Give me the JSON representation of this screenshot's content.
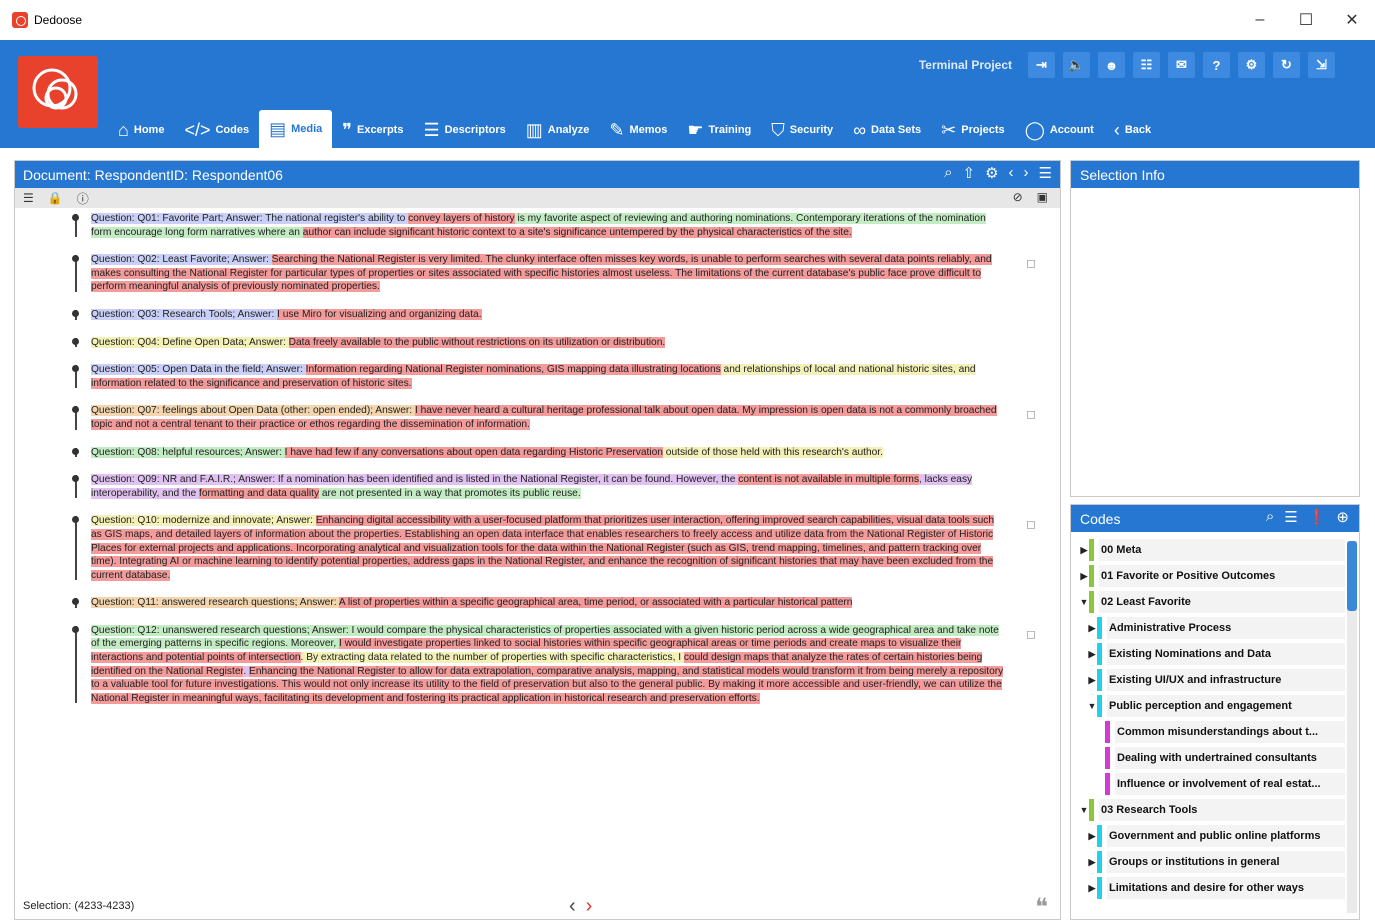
{
  "window": {
    "title": "Dedoose",
    "minimize": "–",
    "maximize": "☐",
    "close": "✕"
  },
  "header": {
    "project_name": "Terminal Project",
    "nav": [
      {
        "label": "Home",
        "icon": "home-icon",
        "glyph": "⌂"
      },
      {
        "label": "Codes",
        "icon": "code-icon",
        "glyph": "</>"
      },
      {
        "label": "Media",
        "icon": "media-icon",
        "glyph": "▤"
      },
      {
        "label": "Excerpts",
        "icon": "quote-icon",
        "glyph": "❞"
      },
      {
        "label": "Descriptors",
        "icon": "document-icon",
        "glyph": "☰"
      },
      {
        "label": "Analyze",
        "icon": "chart-icon",
        "glyph": "▥"
      },
      {
        "label": "Memos",
        "icon": "memo-icon",
        "glyph": "✎"
      },
      {
        "label": "Training",
        "icon": "training-icon",
        "glyph": "☛"
      },
      {
        "label": "Security",
        "icon": "shield-icon",
        "glyph": "⛉"
      },
      {
        "label": "Data Sets",
        "icon": "binoculars-icon",
        "glyph": "∞"
      },
      {
        "label": "Projects",
        "icon": "tools-icon",
        "glyph": "✂"
      },
      {
        "label": "Account",
        "icon": "user-icon",
        "glyph": "◯"
      },
      {
        "label": "Back",
        "icon": "back-icon",
        "glyph": "‹"
      }
    ],
    "active_nav": "Media"
  },
  "document": {
    "title": "Document: RespondentID: Respondent06",
    "paragraphs": [
      {
        "segments": [
          {
            "t": "Question: Q01: Favorite Part; Answer: The national register's ability to ",
            "c": "blue"
          },
          {
            "t": "convey layers of history",
            "c": "red"
          },
          {
            "t": " is my favorite aspect of reviewing and authoring nominations. Contemporary iterations of the nomination form encourage long form narratives where an ",
            "c": "green"
          },
          {
            "t": "author can include significant historic context to a site's significance untempered by the physical characteristics of the site.",
            "c": "red"
          }
        ],
        "memo": false
      },
      {
        "segments": [
          {
            "t": "Question: Q02: Least Favorite; Answer: ",
            "c": "blue"
          },
          {
            "t": "Searching the National Register is very limited. The clunky interface often misses key words, is unable to perform searches with several data points reliably, and makes consulting the National Register for particular types of properties or sites associated with specific histories almost useless. The limitations of the current database's public face prove difficult to perform meaningful analysis of previously nominated properties.",
            "c": "red"
          }
        ],
        "memo": true
      },
      {
        "segments": [
          {
            "t": "Question: Q03: Research Tools; Answer: ",
            "c": "blue"
          },
          {
            "t": "I use Miro for visualizing and organizing data.",
            "c": "red"
          }
        ],
        "memo": false
      },
      {
        "segments": [
          {
            "t": "Question: Q04: Define Open Data; Answer: ",
            "c": "yellow"
          },
          {
            "t": "Data freely available to the public ",
            "c": "red"
          },
          {
            "t": "without restrictions on its utilization or distribution.",
            "c": "red"
          }
        ],
        "memo": false
      },
      {
        "segments": [
          {
            "t": "Question: Q05: Open Data in the field; Answer: ",
            "c": "blue"
          },
          {
            "t": "Information regarding National Register nominations, ",
            "c": "red"
          },
          {
            "t": "GIS mapping data illustrating locations",
            "c": "red"
          },
          {
            "t": " and relationships of local and national historic sites, and ",
            "c": "yellow"
          },
          {
            "t": "information related to the significance and preservation of historic sites.",
            "c": "red"
          }
        ],
        "memo": false
      },
      {
        "segments": [
          {
            "t": "Question: Q07: feelings about Open Data (other: open ended); Answer: ",
            "c": "orange"
          },
          {
            "t": "I have never heard a cultural heritage professional talk about open data. My impression is open data is not a commonly broached topic and not a central tenant to their practice or ethos regarding the dissemination of information.",
            "c": "red"
          }
        ],
        "memo": true
      },
      {
        "segments": [
          {
            "t": "Question: Q08: helpful resources; Answer: ",
            "c": "green"
          },
          {
            "t": "I have had few if any conversations about open data regarding Historic Preservation",
            "c": "red"
          },
          {
            "t": " outside of those held with this research's author.",
            "c": "yellow"
          }
        ],
        "memo": false
      },
      {
        "segments": [
          {
            "t": "Question: Q09: NR and F.A.I.R.; Answer: If a nomination has been identified and is listed in the National Register, it can be found. However, the ",
            "c": "purple"
          },
          {
            "t": "content is not available in multiple forms",
            "c": "red"
          },
          {
            "t": ", lacks easy interoperability, and the ",
            "c": "purple"
          },
          {
            "t": "formatting and data quality",
            "c": "red"
          },
          {
            "t": " are not presented in a way that promotes its public reuse.",
            "c": "green"
          }
        ],
        "memo": false
      },
      {
        "segments": [
          {
            "t": "Question: Q10: modernize and innovate; Answer: ",
            "c": "yellow"
          },
          {
            "t": "Enhancing digital accessibility with a user-focused platform that prioritizes user interaction, offering improved search capabilities, visual data tools such as GIS maps, and detailed layers of information about the properties. Establishing an open data interface that enables researchers to freely access and utilize data from the National Register of Historic Places for external projects and applications. Incorporating analytical and visualization tools for the data within the National Register (such as GIS, trend mapping, timelines, and pattern tracking over time). Integrating AI or machine learning to identify potential properties, address gaps in the National Register, and enhance the recognition of significant histories that may have been excluded from the current database.",
            "c": "red"
          }
        ],
        "memo": true
      },
      {
        "segments": [
          {
            "t": "Question: Q11: answered research questions; Answer: ",
            "c": "orange"
          },
          {
            "t": "A list of properties within a specific geographical area, time period, or associated with a particular historical pattern",
            "c": "red"
          }
        ],
        "memo": false
      },
      {
        "segments": [
          {
            "t": "Question: Q12: unanswered research questions; Answer: I would compare the physical characteristics of properties associated with a given historic period across a wide geographical area and take note of the emerging patterns in specific regions. Moreover, ",
            "c": "green"
          },
          {
            "t": "I would investigate properties linked to social histories within specific geographical areas or time periods and create maps to visualize their interactions and potential points of intersection",
            "c": "red"
          },
          {
            "t": ". By extracting data related to the number of properties with specific characteristics, I ",
            "c": "yellow"
          },
          {
            "t": "could design maps that analyze the rates of certain histories being identified on the National Register",
            "c": "red"
          },
          {
            "t": ". ",
            "c": "purple"
          },
          {
            "t": "Enhancing the National Register to allow for data extrapolation, comparative analysis, mapping, and statistical models would transform it from being merely a repository to a valuable tool for future investigations. This would not only increase its utility to the field of preservation but also to the general public. By making it more accessible and user-friendly, we can utilize the National Register in meaningful ways, facilitating its development and fostering its practical application in historical research and preservation efforts.",
            "c": "red"
          }
        ],
        "memo": true
      }
    ],
    "selection": "Selection: (4233-4233)"
  },
  "selection_info": {
    "title": "Selection Info"
  },
  "codes": {
    "title": "Codes",
    "items": [
      {
        "label": "00 Meta",
        "level": 0,
        "expanded": false,
        "color": "#8cc63f"
      },
      {
        "label": "01 Favorite or Positive Outcomes",
        "level": 0,
        "expanded": false,
        "color": "#8cc63f"
      },
      {
        "label": "02 Least Favorite",
        "level": 0,
        "expanded": true,
        "color": "#8cc63f"
      },
      {
        "label": "Administrative Process",
        "level": 1,
        "expanded": false,
        "color": "#22d0e8"
      },
      {
        "label": "Existing Nominations and Data",
        "level": 1,
        "expanded": false,
        "color": "#22d0e8"
      },
      {
        "label": "Existing UI/UX and infrastructure",
        "level": 1,
        "expanded": false,
        "color": "#22d0e8"
      },
      {
        "label": "Public perception and engagement",
        "level": 1,
        "expanded": true,
        "color": "#22d0e8"
      },
      {
        "label": "Common misunderstandings about t...",
        "level": 2,
        "expanded": null,
        "color": "#d63ad6"
      },
      {
        "label": "Dealing with undertrained consultants",
        "level": 2,
        "expanded": null,
        "color": "#d63ad6"
      },
      {
        "label": "Influence or involvement of real estat...",
        "level": 2,
        "expanded": null,
        "color": "#d63ad6"
      },
      {
        "label": "03 Research Tools",
        "level": 0,
        "expanded": true,
        "color": "#8cc63f"
      },
      {
        "label": "Government and public online platforms",
        "level": 1,
        "expanded": false,
        "color": "#22d0e8"
      },
      {
        "label": "Groups or institutions in general",
        "level": 1,
        "expanded": false,
        "color": "#22d0e8"
      },
      {
        "label": "Limitations and desire for other ways",
        "level": 1,
        "expanded": false,
        "color": "#22d0e8"
      }
    ]
  }
}
